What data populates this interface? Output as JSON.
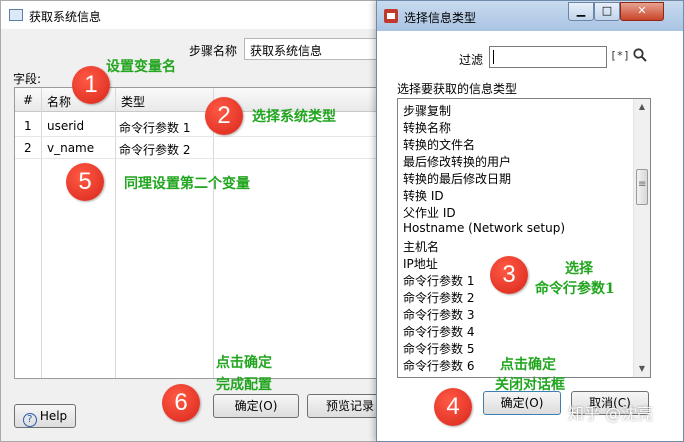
{
  "main_dialog": {
    "title": "获取系统信息",
    "step_name_label": "步骤名称",
    "step_name_value": "获取系统信息",
    "fields_label": "字段:",
    "columns": [
      "#",
      "名称",
      "类型"
    ],
    "rows": [
      {
        "num": "1",
        "name": "userid",
        "type": "命令行参数 1"
      },
      {
        "num": "2",
        "name": "v_name",
        "type": "命令行参数 2"
      }
    ],
    "help_label": "Help",
    "ok_label": "确定(O)",
    "preview_label": "预览记录"
  },
  "select_dialog": {
    "title": "选择信息类型",
    "filter_label": "过滤",
    "filter_value": "",
    "list_label": "选择要获取的信息类型",
    "items": [
      "步骤复制",
      "转换名称",
      "转换的文件名",
      "最后修改转换的用户",
      "转换的最后修改日期",
      "转换 ID",
      "父作业 ID",
      "Hostname (Network setup)",
      "主机名",
      "IP地址",
      "命令行参数 1",
      "命令行参数 2",
      "命令行参数 3",
      "命令行参数 4",
      "命令行参数 5",
      "命令行参数 6"
    ],
    "ok_label": "确定(O)",
    "cancel_label": "取消(C)"
  },
  "annotations": {
    "badge1": "1",
    "text1": "设置变量名",
    "badge2": "2",
    "text2": "选择系统类型",
    "badge3": "3",
    "text3a": "选择",
    "text3b": "命令行参数1",
    "badge4": "4",
    "text4a": "点击确定",
    "text4b": "关闭对话框",
    "badge5": "5",
    "text5": "同理设置第二个变量",
    "badge6": "6",
    "text6a": "点击确定",
    "text6b": "完成配置"
  },
  "watermark": "知乎 @沈亮",
  "colors": {
    "annotation_green": "#22a51f",
    "badge_red": "#e0301e"
  }
}
